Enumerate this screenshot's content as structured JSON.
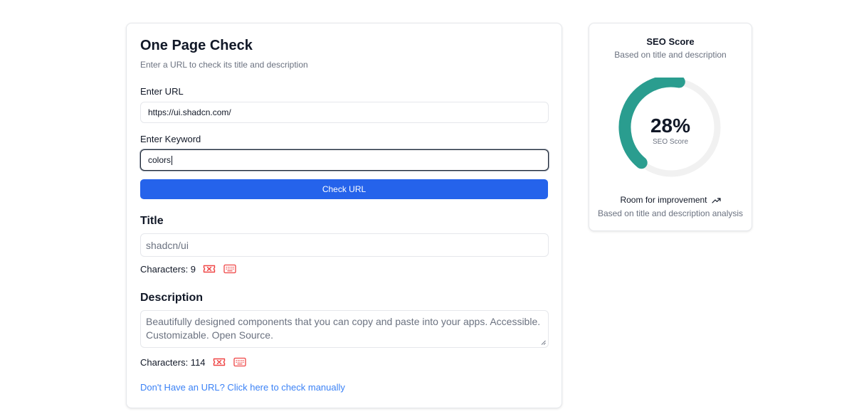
{
  "form": {
    "title": "One Page Check",
    "subtitle": "Enter a URL to check its title and description",
    "url_label": "Enter URL",
    "url_value": "https://ui.shadcn.com/",
    "keyword_label": "Enter Keyword",
    "keyword_value": "colors",
    "check_button": "Check URL"
  },
  "title_section": {
    "heading": "Title",
    "value": "shadcn/ui",
    "char_count": "Characters: 9"
  },
  "description_section": {
    "heading": "Description",
    "value": "Beautifully designed components that you can copy and paste into your apps. Accessible. Customizable. Open Source.",
    "char_count": "Characters: 114"
  },
  "manual_link": "Don't Have an URL? Click here to check manually",
  "score": {
    "heading": "SEO Score",
    "subheading": "Based on title and description",
    "value": 28,
    "value_text": "28%",
    "gauge_label": "SEO Score",
    "status": "Room for improvement",
    "status_sub": "Based on title and description analysis"
  },
  "colors": {
    "accent": "#2563eb",
    "gauge": "#2a9d8f",
    "gauge_track": "#f1f1f1",
    "warning_icon": "#ef4444",
    "link": "#3b82f6"
  },
  "icons": [
    "ticket-x-icon",
    "keyboard-icon",
    "trending-up-icon"
  ]
}
